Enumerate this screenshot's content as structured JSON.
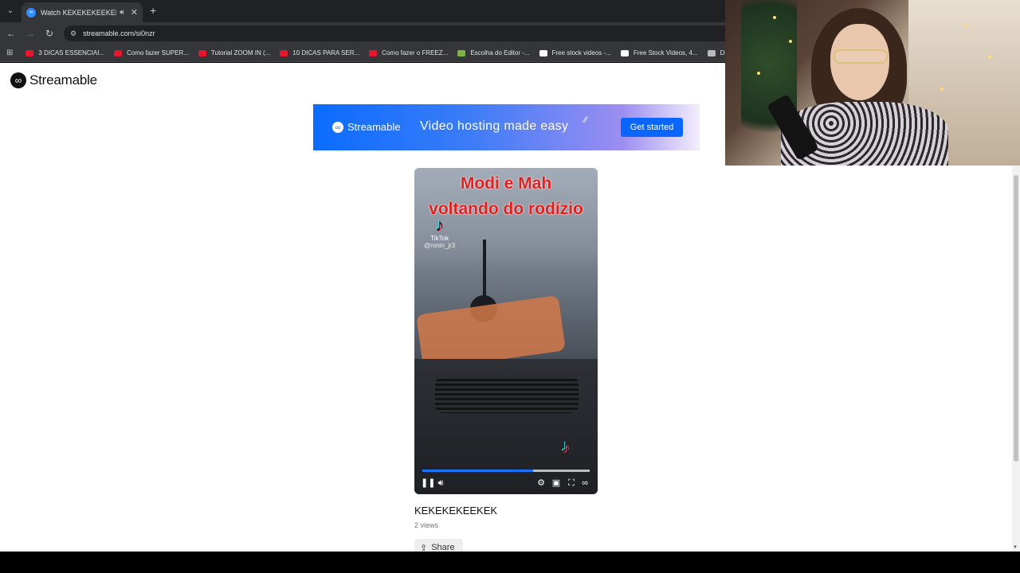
{
  "browser": {
    "tab": {
      "title": "Watch KEKEKEKEEKEK | Stre",
      "favicon": "streamable-icon"
    },
    "url": "streamable.com/si0nzr",
    "bookmarks": [
      {
        "label": "3 DICAS ESSENCIAI...",
        "icon_color": "#e6162d"
      },
      {
        "label": "Como fazer SUPER...",
        "icon_color": "#e6162d"
      },
      {
        "label": "Tutorial ZOOM IN (...",
        "icon_color": "#e6162d"
      },
      {
        "label": "10 DICAS PARA SER...",
        "icon_color": "#e6162d"
      },
      {
        "label": "Como fazer o FREEZ...",
        "icon_color": "#e6162d"
      },
      {
        "label": "Escolha do Editor -...",
        "icon_color": "#7cb342"
      },
      {
        "label": "Free stock videos -...",
        "icon_color": "#ffffff"
      },
      {
        "label": "Free Stock Videos, 4...",
        "icon_color": "#ffffff"
      },
      {
        "label": "Distill: Fre",
        "icon_color": "#bbbbbb"
      }
    ]
  },
  "site": {
    "logo_text": "Streamable",
    "banner": {
      "logo_text": "Streamable",
      "tagline": "Video hosting made easy",
      "cta": "Get started"
    }
  },
  "video": {
    "caption_line1": "Modi e Mah",
    "caption_line2": "voltando do rodízio",
    "watermark_brand": "TikTok",
    "watermark_handle": "@ronin_jr3",
    "progress": 0.66,
    "title": "KEKEKEKEEKEK",
    "views": "2 views",
    "share_label": "Share"
  },
  "colors": {
    "accent": "#0a66ff",
    "caption_red": "#e41d1d"
  }
}
